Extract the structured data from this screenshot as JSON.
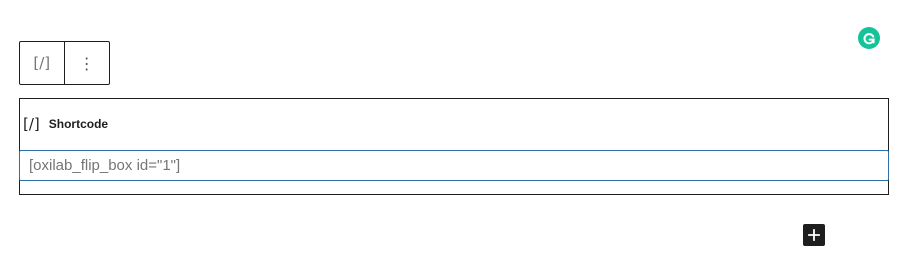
{
  "toolbar": {
    "block_type_icon_text": "[/]",
    "more_options_icon_text": "⋮"
  },
  "shortcode_block": {
    "icon_text": "[/]",
    "title": "Shortcode",
    "input_value": "[oxilab_flip_box id=\"1\"]"
  },
  "icons": {
    "grammarly": "grammarly-icon",
    "add_block": "plus-icon"
  },
  "colors": {
    "grammarly_green": "#15c39a",
    "input_focus_border": "#2d6fa6",
    "dark": "#1e1e1e",
    "muted_text": "#757575"
  }
}
